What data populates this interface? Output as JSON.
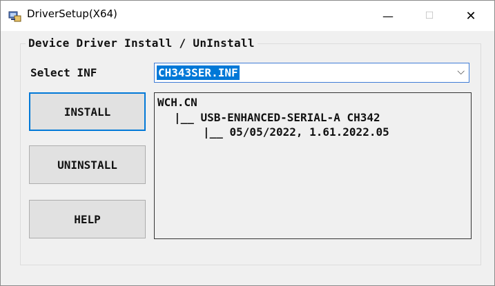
{
  "window": {
    "title": "DriverSetup(X64)",
    "controls": {
      "minimize": "—",
      "maximize": "☐",
      "close": "✕"
    }
  },
  "group": {
    "title": "Device Driver Install / UnInstall"
  },
  "select_inf": {
    "label": "Select INF",
    "selected_value": "CH343SER.INF",
    "arrow": "⌵"
  },
  "buttons": {
    "install": "INSTALL",
    "uninstall": "UNINSTALL",
    "help": "HELP"
  },
  "driver_tree": {
    "line1": "WCH.CN",
    "line2": "|__ USB-ENHANCED-SERIAL-A CH342",
    "line3": "|__ 05/05/2022, 1.61.2022.05"
  },
  "colors": {
    "accent": "#0078d7",
    "window_bg": "#f0f0f0",
    "button_bg": "#e1e1e1"
  }
}
